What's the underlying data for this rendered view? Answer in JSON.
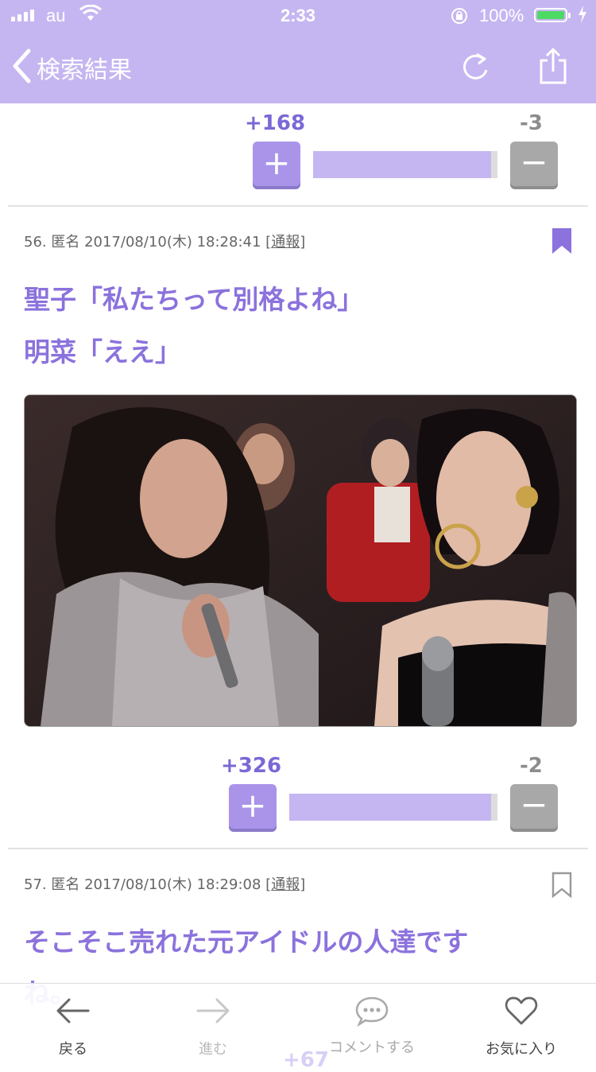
{
  "status_bar": {
    "carrier": "au",
    "time": "2:33",
    "battery_percent": "100%",
    "battery_level": 1.0,
    "battery_color": "#4cd964"
  },
  "nav": {
    "back_label": "検索結果",
    "back_icon": "chevron-left-icon",
    "reload_icon": "reload-icon",
    "share_icon": "share-icon"
  },
  "theme": {
    "accent": "#c5b6f1",
    "post_text": "#8b72dc",
    "minus_gray": "#a8a8a8"
  },
  "prev_vote": {
    "plus": "+168",
    "minus": "-3",
    "plus_symbol": "+",
    "minus_symbol": "−"
  },
  "posts": [
    {
      "meta": "56. 匿名 2017/08/10(木) 18:28:41",
      "report_label": "通報",
      "bookmarked": true,
      "lines": [
        "聖子「私たちって別格よね」",
        "明菜「ええ」"
      ],
      "vote": {
        "plus": "+326",
        "minus": "-2",
        "plus_symbol": "+",
        "minus_symbol": "−"
      }
    },
    {
      "meta": "57. 匿名 2017/08/10(木) 18:29:08",
      "report_label": "通報",
      "bookmarked": false,
      "lines": [
        "そこそこ売れた元アイドルの人達です",
        "ね。"
      ]
    }
  ],
  "tabbar": {
    "items": [
      {
        "label": "戻る",
        "icon": "arrow-left-icon",
        "enabled": true
      },
      {
        "label": "進む",
        "icon": "arrow-right-icon",
        "enabled": false
      },
      {
        "label": "コメントする",
        "icon": "comment-icon",
        "enabled": true
      },
      {
        "label": "お気に入り",
        "icon": "heart-icon",
        "enabled": true
      }
    ]
  },
  "peek_vote": "+67"
}
